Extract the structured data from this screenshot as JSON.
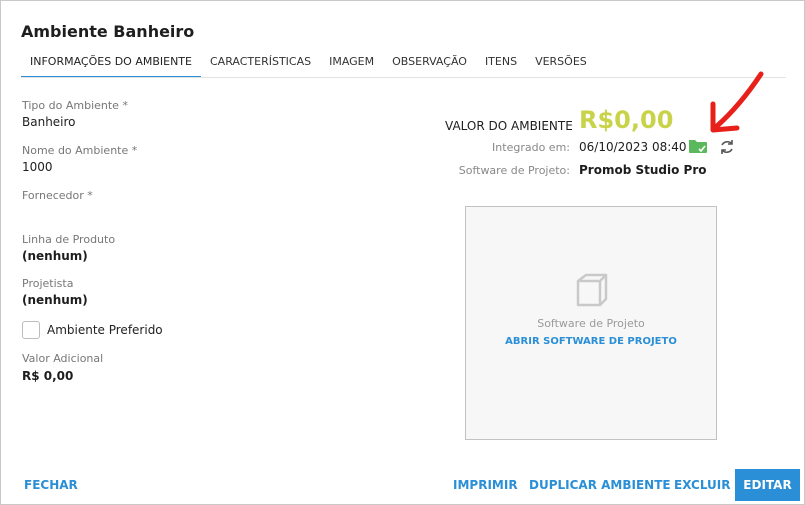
{
  "page": {
    "title": "Ambiente Banheiro"
  },
  "tabs": [
    {
      "label": "INFORMAÇÕES DO AMBIENTE"
    },
    {
      "label": "CARACTERÍSTICAS"
    },
    {
      "label": "IMAGEM"
    },
    {
      "label": "OBSERVAÇÃO"
    },
    {
      "label": "ITENS"
    },
    {
      "label": "VERSÕES"
    }
  ],
  "fields": {
    "tipo": {
      "label": "Tipo do Ambiente *",
      "value": "Banheiro"
    },
    "nome": {
      "label": "Nome do Ambiente *",
      "value": "1000"
    },
    "fornecedor": {
      "label": "Fornecedor *",
      "value": ""
    },
    "linha": {
      "label": "Linha de Produto",
      "value": "(nenhum)"
    },
    "projetista": {
      "label": "Projetista",
      "value": "(nenhum)"
    },
    "preferido": {
      "label": "Ambiente Preferido",
      "checked": false
    },
    "adicional": {
      "label": "Valor Adicional",
      "value": "R$ 0,00"
    }
  },
  "summary": {
    "valor_label": "VALOR DO AMBIENTE",
    "valor_amount": "R$0,00",
    "integrado_label": "Integrado em:",
    "integrado_value": "06/10/2023 08:40",
    "software_label": "Software de Projeto:",
    "software_value": "Promob Studio Pro"
  },
  "preview": {
    "text": "Software de Projeto",
    "link": "ABRIR SOFTWARE DE PROJETO"
  },
  "footer": {
    "fechar": "FECHAR",
    "imprimir": "IMPRIMIR",
    "duplicar": "DUPLICAR AMBIENTE",
    "excluir": "EXCLUIR",
    "editar": "EDITAR"
  },
  "icons": {
    "folder": "folder-check-icon",
    "sync": "sync-icon",
    "cube": "cube-icon",
    "annotation": "red-arrow-annotation"
  },
  "colors": {
    "accent": "#2a8fd6",
    "amount": "#c8d34a",
    "folder": "#5cb85c",
    "arrow": "#e8201a"
  }
}
